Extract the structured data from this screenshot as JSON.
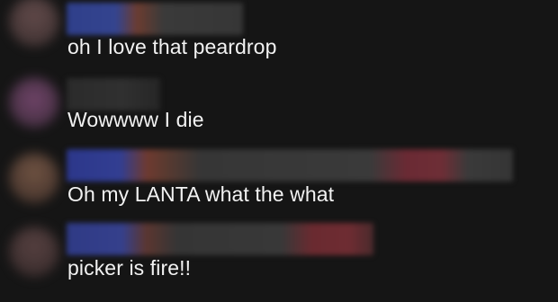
{
  "comments": [
    {
      "text": "oh I love that peardrop",
      "avatar_color": "#4a3c3c",
      "name_colors": [
        "#2f3f8a",
        "#6b3c30",
        "#3a3a3a"
      ]
    },
    {
      "text": "Wowwww I die",
      "avatar_color": "#5a3a55",
      "name_colors": [
        "#2a2a2a",
        "#2e2e2e",
        "#262626"
      ]
    },
    {
      "text": "Oh my LANTA what the what",
      "avatar_color": "#5a4236",
      "name_colors": [
        "#2c378a",
        "#6e3a30",
        "#363636",
        "#6a2a34"
      ]
    },
    {
      "text": "picker is fire!!",
      "avatar_color": "#4a3838",
      "name_colors": [
        "#2f3a85",
        "#5b3630",
        "#353535",
        "#6a2a30"
      ]
    }
  ]
}
